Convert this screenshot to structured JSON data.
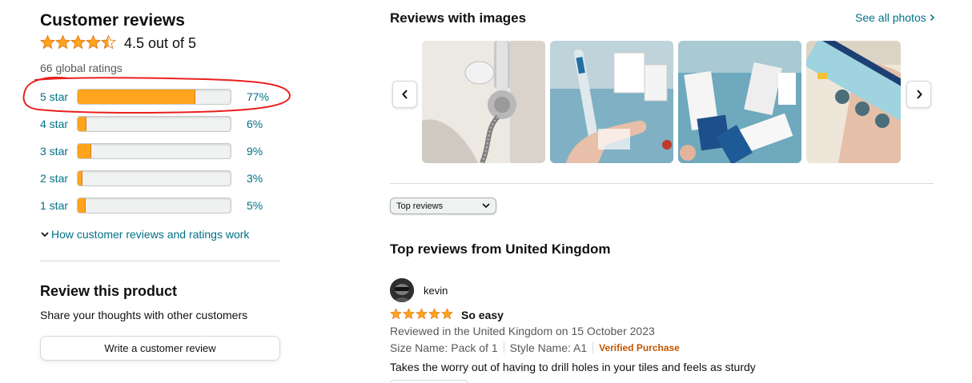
{
  "summary": {
    "title": "Customer reviews",
    "rating": 4.5,
    "rating_text": "4.5 out of 5",
    "global_ratings": "66 global ratings"
  },
  "histogram": [
    {
      "label": "5 star",
      "percent_text": "77%",
      "percent": 77
    },
    {
      "label": "4 star",
      "percent_text": "6%",
      "percent": 6
    },
    {
      "label": "3 star",
      "percent_text": "9%",
      "percent": 9
    },
    {
      "label": "2 star",
      "percent_text": "3%",
      "percent": 3
    },
    {
      "label": "1 star",
      "percent_text": "5%",
      "percent": 5
    }
  ],
  "how_link": "How customer reviews and ratings work",
  "review_product": {
    "title": "Review this product",
    "subtitle": "Share your thoughts with other customers",
    "button": "Write a customer review"
  },
  "images_section": {
    "title": "Reviews with images",
    "see_all": "See all photos"
  },
  "sort": {
    "selected": "Top reviews"
  },
  "top_reviews": {
    "title": "Top reviews from United Kingdom",
    "review": {
      "reviewer": "kevin",
      "rating": 5,
      "title": "So easy",
      "date": "Reviewed in the United Kingdom on 15 October 2023",
      "size": "Size Name: Pack of 1",
      "style": "Style Name: A1",
      "verified": "Verified Purchase",
      "body": "Takes the worry out of having to drill holes in your tiles and feels as sturdy"
    }
  },
  "colors": {
    "star": "#ffa41c",
    "link": "#007185",
    "annotation": "#e8211f",
    "verified": "#c45500"
  },
  "icons": [
    "star-icon",
    "chevron-down-icon",
    "chevron-left-icon",
    "chevron-right-icon"
  ]
}
